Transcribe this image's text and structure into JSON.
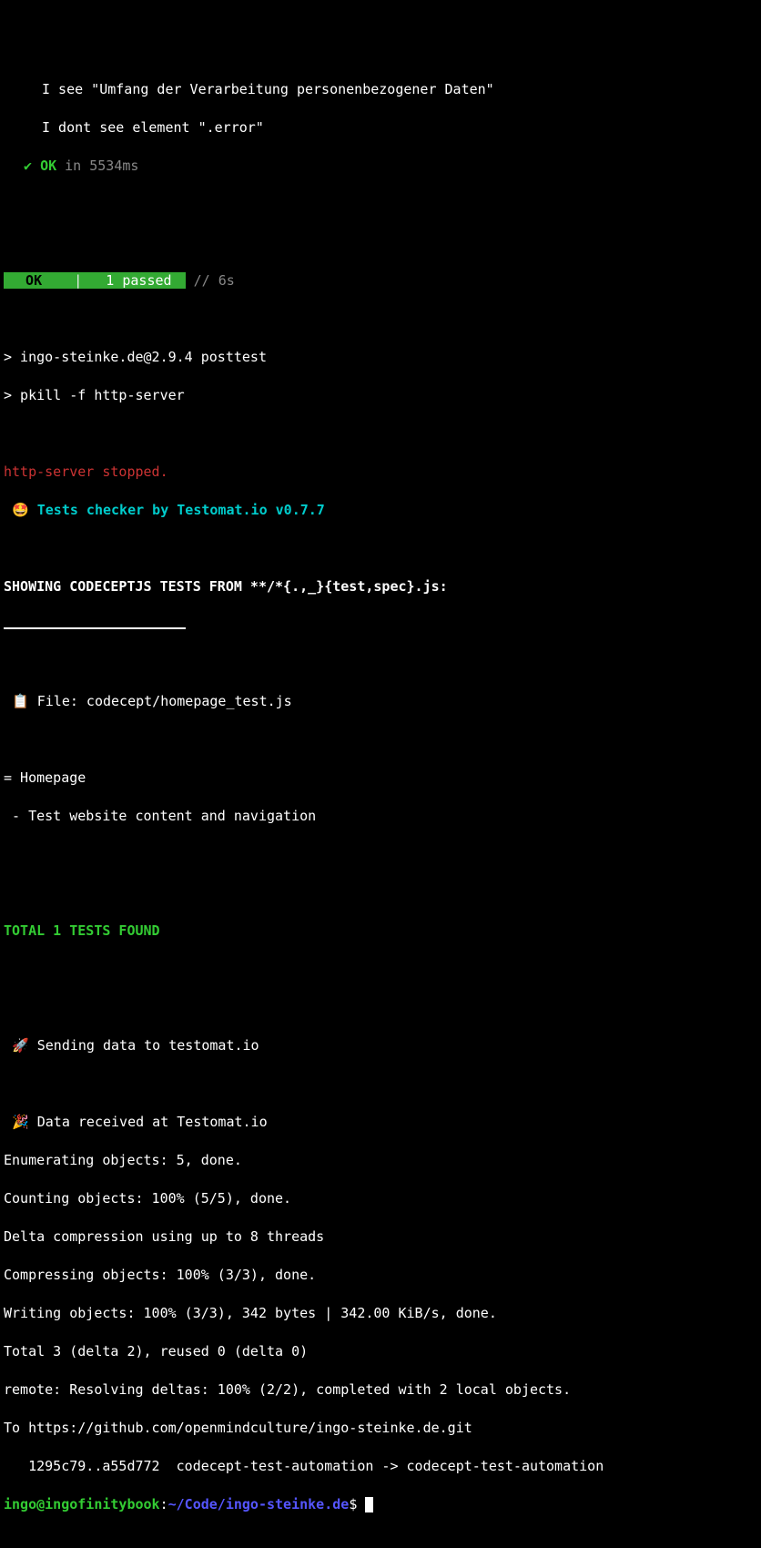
{
  "test_output": {
    "step1": "I see \"Umfang der Verarbeitung personenbezogener Daten\"",
    "step2": "I dont see element \".error\"",
    "check": "✔ ",
    "ok": "OK",
    "timing": " in 5534ms"
  },
  "summary": {
    "ok_label": "  OK  ",
    "sep": " | ",
    "passed": " 1 passed ",
    "duration": " // 6s"
  },
  "posttest": {
    "line1": "> ingo-steinke.de@2.9.4 posttest",
    "line2": "> pkill -f http-server"
  },
  "http_stopped": "http-server stopped.",
  "testomat": {
    "emoji": "🤩",
    "checker": " Tests checker by Testomat.io v0.7.7"
  },
  "showing": "SHOWING CODECEPTJS TESTS FROM **/*{.,_}{test,spec}.js:",
  "file": {
    "icon": "📋",
    "label": " File: codecept/homepage_test.js"
  },
  "suite": {
    "header": "= Homepage",
    "test": " - Test website content and navigation"
  },
  "total": "TOTAL 1 TESTS FOUND",
  "sending": {
    "icon": "🚀",
    "label": " Sending data to testomat.io"
  },
  "received": {
    "icon": "🎉",
    "label": " Data received at Testomat.io"
  },
  "git": {
    "enum": "Enumerating objects: 5, done.",
    "count": "Counting objects: 100% (5/5), done.",
    "delta": "Delta compression using up to 8 threads",
    "compress": "Compressing objects: 100% (3/3), done.",
    "write": "Writing objects: 100% (3/3), 342 bytes | 342.00 KiB/s, done.",
    "total": "Total 3 (delta 2), reused 0 (delta 0)",
    "remote": "remote: Resolving deltas: 100% (2/2), completed with 2 local objects.",
    "to": "To https://github.com/openmindculture/ingo-steinke.de.git",
    "ref": "   1295c79..a55d772  codecept-test-automation -> codecept-test-automation"
  },
  "prompt": {
    "user_host": "ingo@ingofinitybook",
    "colon": ":",
    "path": "~/Code/ingo-steinke.de",
    "symbol": "$ "
  }
}
